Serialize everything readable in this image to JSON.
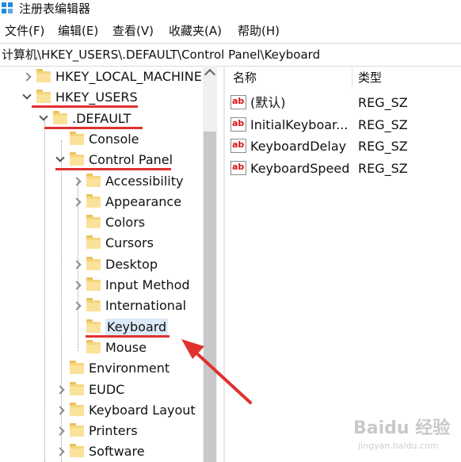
{
  "window": {
    "title": "注册表编辑器"
  },
  "menu": [
    "文件(F)",
    "编辑(E)",
    "查看(V)",
    "收藏夹(A)",
    "帮助(H)"
  ],
  "address": "计算机\\HKEY_USERS\\.DEFAULT\\Control Panel\\Keyboard",
  "tree": [
    {
      "label": "HKEY_LOCAL_MACHINE",
      "expander": "collapsed"
    },
    {
      "label": "HKEY_USERS",
      "expander": "expanded",
      "highlighted": true
    },
    {
      "label": ".DEFAULT",
      "expander": "expanded",
      "highlighted": true
    },
    {
      "label": "Console",
      "expander": "none"
    },
    {
      "label": "Control Panel",
      "expander": "expanded",
      "highlighted": true
    },
    {
      "label": "Accessibility",
      "expander": "collapsed"
    },
    {
      "label": "Appearance",
      "expander": "collapsed"
    },
    {
      "label": "Colors",
      "expander": "none"
    },
    {
      "label": "Cursors",
      "expander": "none"
    },
    {
      "label": "Desktop",
      "expander": "collapsed"
    },
    {
      "label": "Input Method",
      "expander": "collapsed"
    },
    {
      "label": "International",
      "expander": "collapsed"
    },
    {
      "label": "Keyboard",
      "expander": "none",
      "selected": true,
      "highlighted": true
    },
    {
      "label": "Mouse",
      "expander": "none"
    },
    {
      "label": "Environment",
      "expander": "none"
    },
    {
      "label": "EUDC",
      "expander": "collapsed"
    },
    {
      "label": "Keyboard Layout",
      "expander": "collapsed"
    },
    {
      "label": "Printers",
      "expander": "collapsed"
    },
    {
      "label": "Software",
      "expander": "collapsed"
    }
  ],
  "list": {
    "columns": [
      "名称",
      "类型"
    ],
    "rows": [
      {
        "name": "(默认)",
        "type": "REG_SZ",
        "icon": "string-value-icon"
      },
      {
        "name": "InitialKeyboar...",
        "type": "REG_SZ",
        "icon": "string-value-icon"
      },
      {
        "name": "KeyboardDelay",
        "type": "REG_SZ",
        "icon": "string-value-icon"
      },
      {
        "name": "KeyboardSpeed",
        "type": "REG_SZ",
        "icon": "string-value-icon"
      }
    ],
    "icon_text": "ab"
  },
  "annotation": {
    "color": "#e0312f"
  },
  "watermark": {
    "text": "Baidu 经验",
    "sub": "jingyan.baidu.com"
  }
}
